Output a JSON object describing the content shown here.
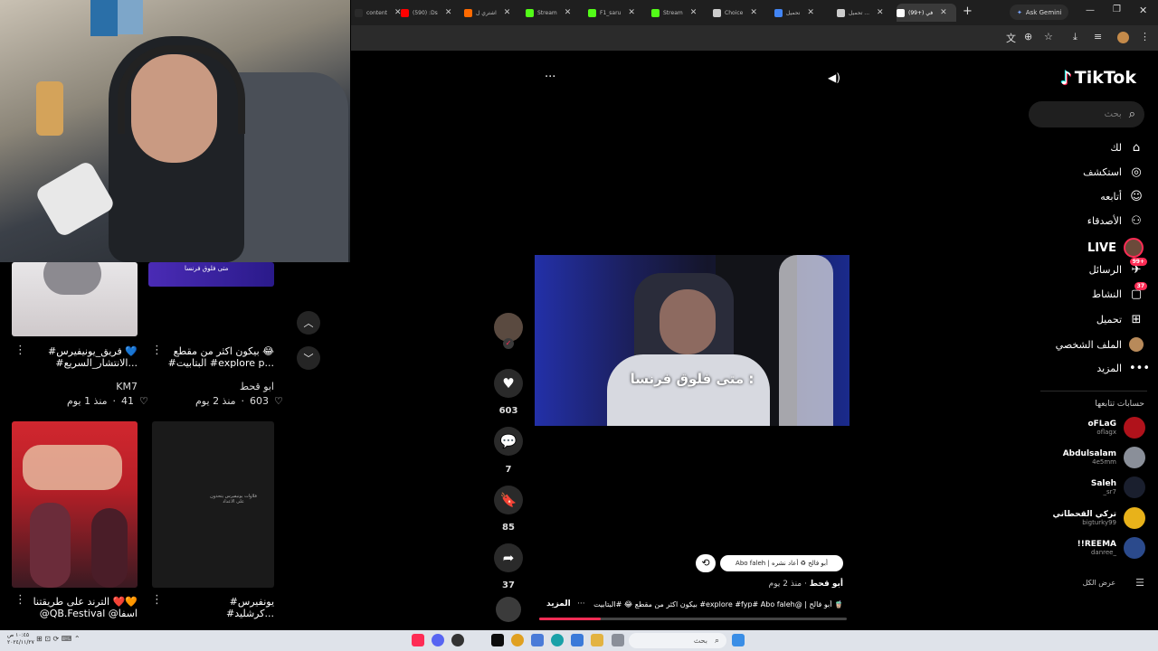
{
  "browser": {
    "tabs": [
      {
        "label": "content",
        "color": "#2a2a2a"
      },
      {
        "label": "(590) :Ds",
        "color": "#ff0000"
      },
      {
        "label": "اشتري ل",
        "color": "#ff6a00"
      },
      {
        "label": "Stream",
        "color": "#53fc18"
      },
      {
        "label": "F1_saru",
        "color": "#53fc18"
      },
      {
        "label": "Stream",
        "color": "#53fc18"
      },
      {
        "label": "Choice",
        "color": "#cccccc"
      },
      {
        "label": "تحميل",
        "color": "#4285f4"
      },
      {
        "label": "تحميل ...",
        "color": "#cccccc"
      },
      {
        "label": "(99+) ‏في",
        "color": "#ffffff"
      }
    ],
    "new_tab": "+",
    "gemini": "Ask Gemini"
  },
  "tiktok": {
    "logo": "TikTok",
    "search_placeholder": "بحث",
    "nav": [
      {
        "label": "لك",
        "icon": "home-icon",
        "glyph": "⌂"
      },
      {
        "label": "استكشف",
        "icon": "compass-icon",
        "glyph": "◎"
      },
      {
        "label": "أتابعه",
        "icon": "following-icon",
        "glyph": "☺"
      },
      {
        "label": "الأصدقاء",
        "icon": "friends-icon",
        "glyph": "⚇"
      },
      {
        "label": "LIVE",
        "icon": "live-icon",
        "glyph": "●"
      },
      {
        "label": "الرسائل",
        "icon": "messages-icon",
        "glyph": "✈",
        "badge": "99+"
      },
      {
        "label": "النشاط",
        "icon": "activity-icon",
        "glyph": "▢",
        "badge": "37"
      },
      {
        "label": "تحميل",
        "icon": "upload-icon",
        "glyph": "⊞"
      },
      {
        "label": "الملف الشخصي",
        "icon": "profile-icon",
        "glyph": "●"
      },
      {
        "label": "المزيد",
        "icon": "more-icon",
        "glyph": "•••"
      }
    ],
    "following_title": "حسابات تتابعها",
    "following": [
      {
        "name": "oFLaG",
        "handle": "oflagx",
        "color": "#b0121b"
      },
      {
        "name": "Abdulsalam",
        "handle": "4e5mm",
        "color": "#8a8f99"
      },
      {
        "name": "Saleh",
        "handle": "_sr7",
        "color": "#1a1f2e"
      },
      {
        "name": "تركي القحطاني",
        "handle": "bigturky99",
        "color": "#e8b21a"
      },
      {
        "name": "!!REEMA",
        "handle": "danree_",
        "color": "#2b4a8c"
      }
    ],
    "see_all": "عرض الكل"
  },
  "video": {
    "subtitle": "متى فلوق فرنسا :",
    "actions": {
      "likes": "603",
      "comments": "7",
      "saves": "85",
      "shares": "37"
    },
    "repost_chip": "Abo faleh | أبو فالح ♻ أعاد نشره",
    "author": "أبو قحط",
    "posted": "منذ 2 يوم",
    "caption": "بيكون اكثر من مقطع 😂 #البتابيت #explore #fyp# Abo faleh@ | أبو فالح 🧋",
    "more": "المزيد",
    "more_dots": "···"
  },
  "grid": [
    {
      "caption_line1": "#فريق_يونيفيرس 💙",
      "caption_line2": "#الانتشار_السريع...",
      "author": "KM7",
      "likes": "41",
      "age": "منذ 1 يوم"
    },
    {
      "caption_line1": "بيكون اكثر من مقطع 😂",
      "caption_line2": "#البتابيت #explore p...",
      "author": "ابو قحط",
      "likes": "603",
      "age": "منذ 2 يوم"
    },
    {
      "caption_line1": "الترند على طريقتنا ❤️🧡",
      "caption_line2": "@QB.Festival @اسفا"
    },
    {
      "caption_line1": "#يونفيرس",
      "caption_line2": "#كرشليد..."
    }
  ],
  "video_thumb_text": "متى فلوق فرنسا",
  "thumb_dark_text": "فلاوات يونيفيرس يتحدون على الاعداد",
  "taskbar": {
    "search": "بحث",
    "time": "١٠:٤٥ ص",
    "date": "٢٠٢٤/١١/٢٧"
  }
}
